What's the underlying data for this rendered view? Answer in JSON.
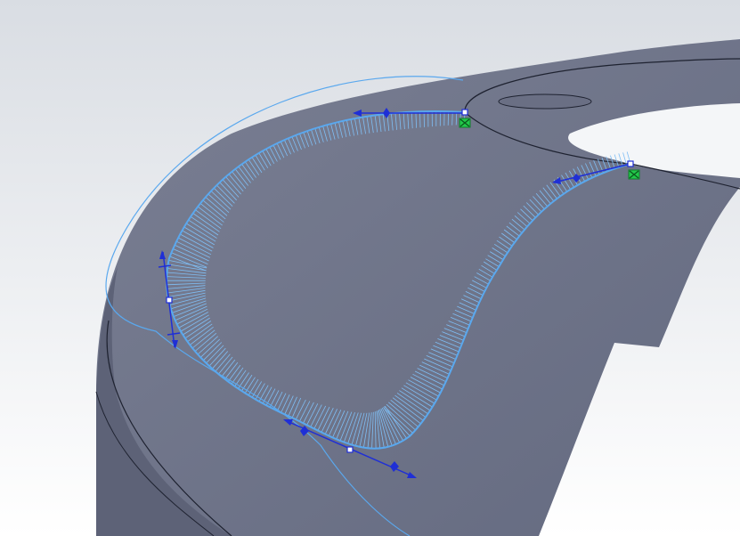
{
  "viewport": {
    "background_top": "#d9dde3",
    "background_bottom": "#ffffff"
  },
  "model": {
    "face_color": "#6f7489",
    "face_dark": "#5f6479",
    "edge_color": "#1e2230"
  },
  "curve": {
    "color": "#5aa8ee",
    "comb_color": "#7fbef4",
    "handle_color": "#1f2fd6",
    "endpoint_marker_color": "#22c94a",
    "icons": [
      "handle-arrow-icon",
      "control-point-icon",
      "coincident-relation-icon"
    ]
  }
}
